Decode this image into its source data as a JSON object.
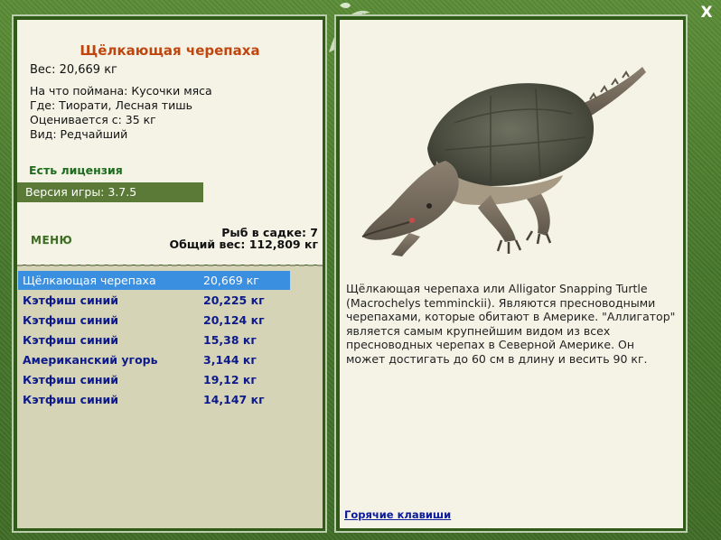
{
  "window": {
    "close_label": "X"
  },
  "fish": {
    "title": "Щёлкающая черепаха",
    "weight_line": "Вес: 20,669 кг",
    "caught_on": "На что поймана: Кусочки мяса",
    "location": "Где: Тиорати, Лесная тишь",
    "value": "Оценивается с: 35 кг",
    "rarity": "Вид: Редчайший",
    "description": "Щёлкающая черепаха или Alligator Snapping Turtle (Macrochelys temminckii). Являются пресноводными черепахами, которые обитают в Америке. \"Аллигатор\" является самым крупнейшим видом из всех пресноводных черепах в Северной Америке. Он может достигать до 60 см в длину и весить 90 кг."
  },
  "status": {
    "license": "Есть лицензия",
    "version": "Версия игры: 3.7.5",
    "menu_label": "МЕНЮ",
    "keep_count": "Рыб в садке: 7",
    "total_weight": "Общий вес: 112,809 кг"
  },
  "catch_list": [
    {
      "name": "Щёлкающая черепаха",
      "weight": "20,669 кг",
      "selected": true
    },
    {
      "name": "Кэтфиш синий",
      "weight": "20,225 кг",
      "selected": false
    },
    {
      "name": "Кэтфиш синий",
      "weight": "20,124 кг",
      "selected": false
    },
    {
      "name": "Кэтфиш синий",
      "weight": "15,38 кг",
      "selected": false
    },
    {
      "name": "Американский угорь",
      "weight": "3,144 кг",
      "selected": false
    },
    {
      "name": "Кэтфиш синий",
      "weight": "19,12 кг",
      "selected": false
    },
    {
      "name": "Кэтфиш синий",
      "weight": "14,147 кг",
      "selected": false
    }
  ],
  "footer": {
    "hotkeys_label": "Горячие клавиши"
  },
  "colors": {
    "frame": "#4a7a2c",
    "panel": "#f4f3e6",
    "title": "#c0460e",
    "license": "#1d6b1d",
    "selected_row": "#3a8fe0",
    "list_text": "#0c1a8c"
  },
  "icons": [
    "close-icon",
    "fish-logo-icon"
  ]
}
